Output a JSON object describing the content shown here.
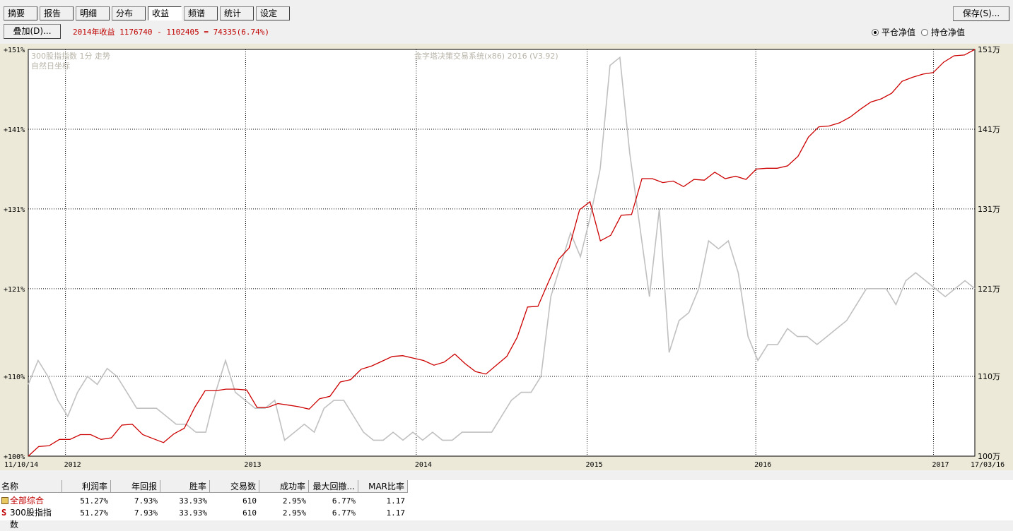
{
  "toolbar": {
    "tabs": [
      "摘要",
      "报告",
      "明细",
      "分布",
      "收益",
      "频谱",
      "统计",
      "设定"
    ],
    "active_tab": "收益",
    "save_label": "保存(S)...",
    "overlay_label": "叠加(D)..."
  },
  "summary_text": "2014年收益 1176740 - 1102405 = 74335(6.74%)",
  "radio": {
    "flat_label": "平仓净值",
    "hold_label": "持仓净值",
    "selected": "平仓净值"
  },
  "chart": {
    "watermark_left": "300股指指数 1分 走势",
    "watermark_left2": "自然日坐标",
    "watermark_center": "金字塔决策交易系统(x86) 2016 (V3.92)",
    "left_ticks": [
      "+151%",
      "+141%",
      "+131%",
      "+121%",
      "+110%",
      "+100%"
    ],
    "right_ticks": [
      "151万",
      "141万",
      "131万",
      "121万",
      "110万",
      "100万"
    ],
    "x_start": "11/10/14",
    "x_end": "17/03/16",
    "year_ticks": [
      "2012",
      "2013",
      "2014",
      "2015",
      "2016",
      "2017"
    ],
    "colors": {
      "equity": "#cc0000",
      "index": "#c0c0c0",
      "grid": "#000000"
    }
  },
  "chart_data": {
    "type": "line",
    "xlabel": "",
    "ylabel": "",
    "ylim_left_pct": [
      100,
      151
    ],
    "ylim_right_wan": [
      100,
      151
    ],
    "series": [
      {
        "values_pct": [
          100,
          101.2,
          101.3,
          102.1,
          102.1,
          102.7,
          102.7,
          102.1,
          102.3,
          103.9,
          104,
          102.7,
          102.2,
          101.7,
          102.8,
          103.5,
          106.1,
          108.2,
          108.2,
          108.4,
          108.4,
          108.3,
          106.1,
          106.1,
          106.6,
          106.4,
          106.2,
          105.9,
          107.2,
          107.5,
          109.3,
          109.6,
          110.9,
          111.3,
          111.9,
          112.5,
          112.6,
          112.3,
          112,
          111.4,
          111.8,
          112.8,
          111.6,
          110.6,
          110.3,
          111.4,
          112.5,
          114.9,
          118.7,
          118.8,
          121.8,
          124.7,
          126.1,
          130.9,
          131.9,
          127,
          127.7,
          130.2,
          130.3,
          134.8,
          134.8,
          134.3,
          134.5,
          133.8,
          134.7,
          134.6,
          135.6,
          134.8,
          135.1,
          134.7,
          136,
          136.1,
          136.1,
          136.4,
          137.6,
          140,
          141.3,
          141.4,
          141.8,
          142.5,
          143.5,
          144.4,
          144.8,
          145.5,
          147,
          147.5,
          147.9,
          148.1,
          149.4,
          150.2,
          150.3,
          151
        ]
      },
      {
        "values_pct": [
          109,
          112,
          110,
          107,
          105,
          108,
          110,
          109,
          111,
          110,
          108,
          106,
          106,
          106,
          105,
          104,
          104,
          103,
          103,
          108,
          112,
          108,
          107,
          106,
          106,
          107,
          102,
          103,
          104,
          103,
          106,
          107,
          107,
          105,
          103,
          102,
          102,
          103,
          102,
          103,
          102,
          103,
          102,
          102,
          103,
          103,
          103,
          103,
          105,
          107,
          108,
          108,
          110,
          120,
          124,
          128,
          125,
          130,
          136,
          149,
          150,
          138,
          129,
          120,
          131,
          113,
          117,
          118,
          121,
          127,
          126,
          127,
          123,
          115,
          112,
          114,
          114,
          116,
          115,
          115,
          114,
          115,
          116,
          117,
          119,
          121,
          121,
          121,
          119,
          122,
          123,
          122,
          121,
          120,
          121,
          122,
          121
        ]
      }
    ]
  },
  "table": {
    "headers": [
      "名称",
      "利润率",
      "年回报",
      "胜率",
      "交易数",
      "成功率",
      "最大回撤...",
      "MAR比率"
    ],
    "rows": [
      {
        "name": "全部综合",
        "values": [
          "51.27%",
          "7.93%",
          "33.93%",
          "610",
          "2.95%",
          "6.77%",
          "1.17"
        ]
      },
      {
        "name": "300股指指数",
        "values": [
          "51.27%",
          "7.93%",
          "33.93%",
          "610",
          "2.95%",
          "6.77%",
          "1.17"
        ]
      }
    ]
  }
}
